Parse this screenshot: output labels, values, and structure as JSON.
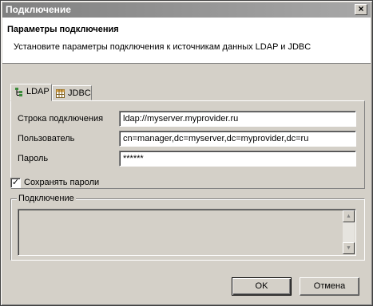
{
  "window": {
    "title": "Подключение",
    "close_glyph": "×"
  },
  "header": {
    "title": "Параметры подключения",
    "description": "Установите параметры подключения к источникам данных LDAP и JDBC"
  },
  "tabs": [
    {
      "label": "LDAP",
      "active": true,
      "icon": "ldap-tree-icon"
    },
    {
      "label": "JDBC",
      "active": false,
      "icon": "table-icon"
    }
  ],
  "form": {
    "connection_string": {
      "label": "Строка подключения",
      "value": "ldap://myserver.myprovider.ru"
    },
    "user": {
      "label": "Пользователь",
      "value": "cn=manager,dc=myserver,dc=myprovider,dc=ru"
    },
    "password": {
      "label": "Пароль",
      "value": "******"
    }
  },
  "save_passwords": {
    "label": "Сохранять пароли",
    "checked": true,
    "check_glyph": "✓"
  },
  "connection_group": {
    "legend": "Подключение",
    "text": ""
  },
  "scrollbar": {
    "up_glyph": "▲",
    "down_glyph": "▼"
  },
  "buttons": {
    "ok": "OK",
    "cancel": "Отмена"
  },
  "colors": {
    "face": "#d4d0c8",
    "titlebar_start": "#808080",
    "titlebar_end": "#a8a8a8",
    "header_bg": "#ffffff"
  }
}
